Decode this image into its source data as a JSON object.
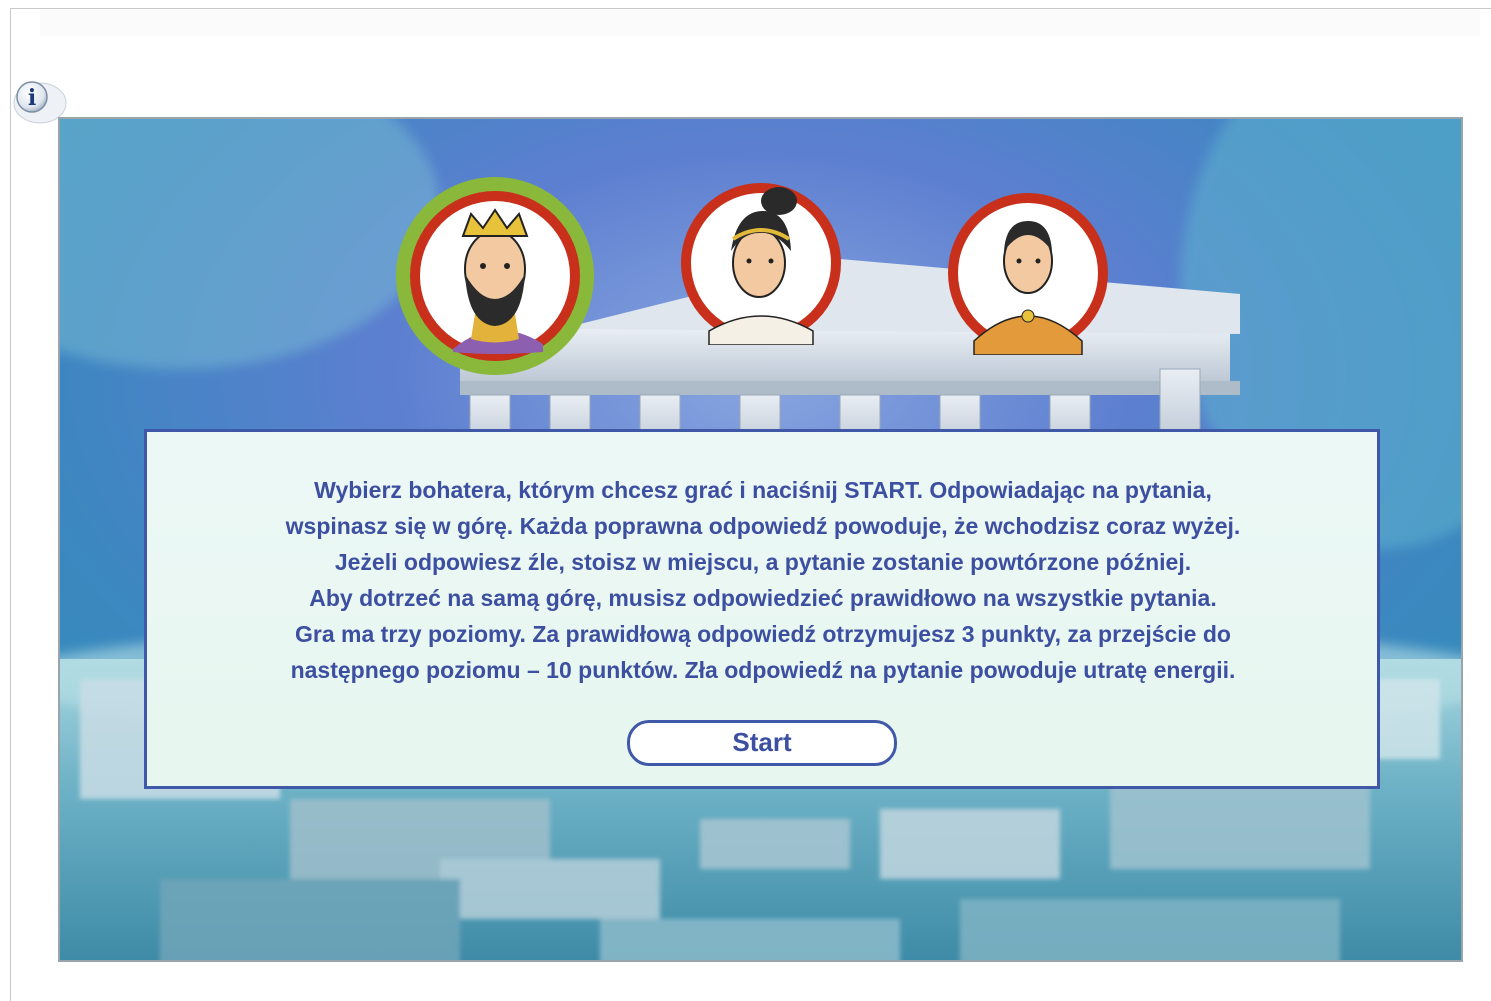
{
  "info_button": {
    "icon": "info-icon",
    "glyph": "i"
  },
  "heroes": [
    {
      "name": "hero-king",
      "selected": true
    },
    {
      "name": "hero-woman",
      "selected": false
    },
    {
      "name": "hero-youth",
      "selected": false
    }
  ],
  "instructions": {
    "lines": [
      "Wybierz bohatera, którym chcesz grać i naciśnij START. Odpowiadając na pytania,",
      "wspinasz się w górę. Każda poprawna odpowiedź powoduje, że wchodzisz coraz wyżej.",
      "Jeżeli odpowiesz źle, stoisz w miejscu, a pytanie zostanie powtórzone później.",
      "Aby dotrzeć na samą górę, musisz odpowiedzieć prawidłowo na wszystkie pytania.",
      "Gra ma trzy poziomy. Za prawidłową odpowiedź otrzymujesz 3 punkty, za przejście do",
      "następnego poziomu – 10 punktów. Zła odpowiedź na pytanie powoduje utratę energii."
    ]
  },
  "start_button": {
    "label": "Start"
  },
  "colors": {
    "text": "#3c4fa0",
    "box_border": "#3f58a8",
    "selected_ring": "#8ab83a",
    "portrait_ring": "#c8301c"
  }
}
